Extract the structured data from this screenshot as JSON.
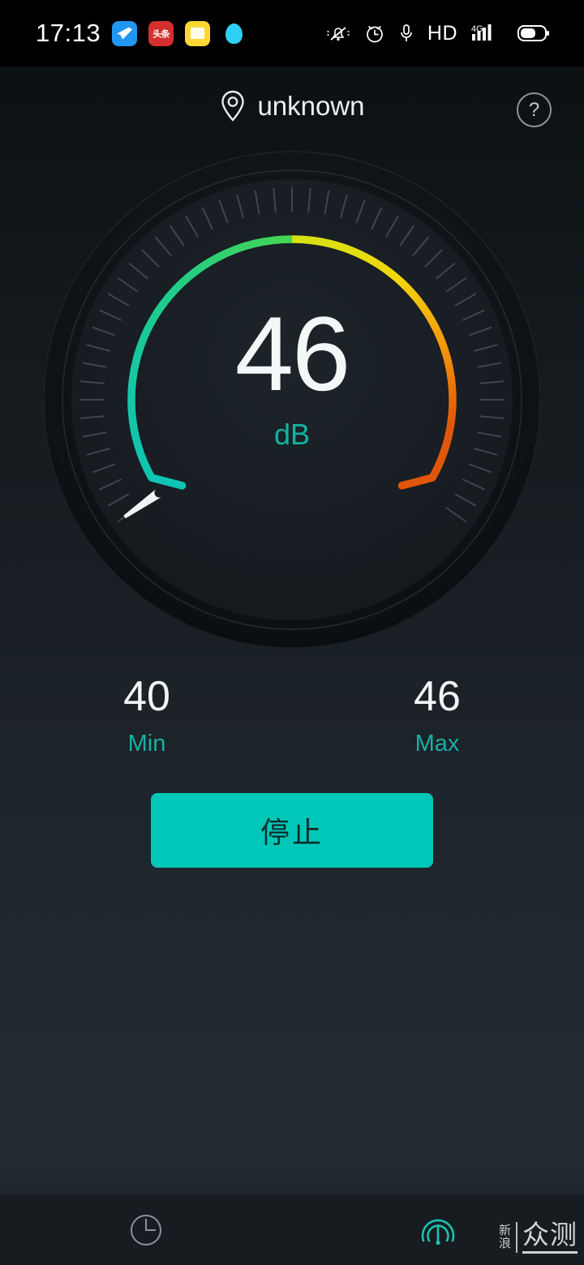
{
  "statusbar": {
    "time": "17:13",
    "app_icons": [
      {
        "name": "blue-bird-app-icon",
        "label": ""
      },
      {
        "name": "toutiao-app-icon",
        "label": "头条"
      },
      {
        "name": "yellow-folder-app-icon",
        "label": ""
      },
      {
        "name": "qq-penguin-app-icon",
        "label": ""
      }
    ],
    "right_icons": [
      {
        "name": "bell-mute-icon"
      },
      {
        "name": "alarm-clock-icon"
      },
      {
        "name": "microphone-icon"
      },
      {
        "name": "hd-icon",
        "label": "HD"
      },
      {
        "name": "signal-4g-icon",
        "label": "4G"
      },
      {
        "name": "battery-icon"
      }
    ],
    "hd_label": "HD",
    "network_label": "4G"
  },
  "header": {
    "location": "unknown",
    "help_label": "?"
  },
  "gauge": {
    "value": "46",
    "unit": "dB",
    "needle_value": 46,
    "arc_start_color": "#0ec4b4",
    "arc_mid_color": "#3fd45a",
    "arc_yellow_color": "#f1e40d",
    "arc_end_color": "#e15a0a",
    "tick_color": "#585f64",
    "needle_color": "#ffffff"
  },
  "stats": {
    "min": {
      "value": "40",
      "label": "Min"
    },
    "max": {
      "value": "46",
      "label": "Max"
    }
  },
  "action": {
    "label": "停止"
  },
  "bottomnav": {
    "items": [
      {
        "name": "history-tab",
        "icon": "clock-icon",
        "active": false
      },
      {
        "name": "meter-tab",
        "icon": "gauge-icon",
        "active": true
      }
    ],
    "active_color": "#19c3b2",
    "inactive_color": "#8a9197"
  },
  "watermark": {
    "small": "新\n浪",
    "small_line1": "新",
    "small_line2": "浪",
    "big": "众测"
  },
  "chart_data": {
    "type": "gauge",
    "title": "Sound level meter",
    "value": 46,
    "unit": "dB",
    "min_recorded": 40,
    "max_recorded": 46,
    "range": [
      0,
      130
    ],
    "arc_sweep_degrees": 250,
    "arc_start_angle_deg": 145,
    "needle_angle_deg": 145,
    "gradient_stops": [
      {
        "pos": 0.0,
        "color": "#0ec4b4"
      },
      {
        "pos": 0.33,
        "color": "#3fd45a"
      },
      {
        "pos": 0.5,
        "color": "#b9e014"
      },
      {
        "pos": 0.63,
        "color": "#f1e40d"
      },
      {
        "pos": 0.85,
        "color": "#f59c0b"
      },
      {
        "pos": 1.0,
        "color": "#e15a0a"
      }
    ]
  }
}
